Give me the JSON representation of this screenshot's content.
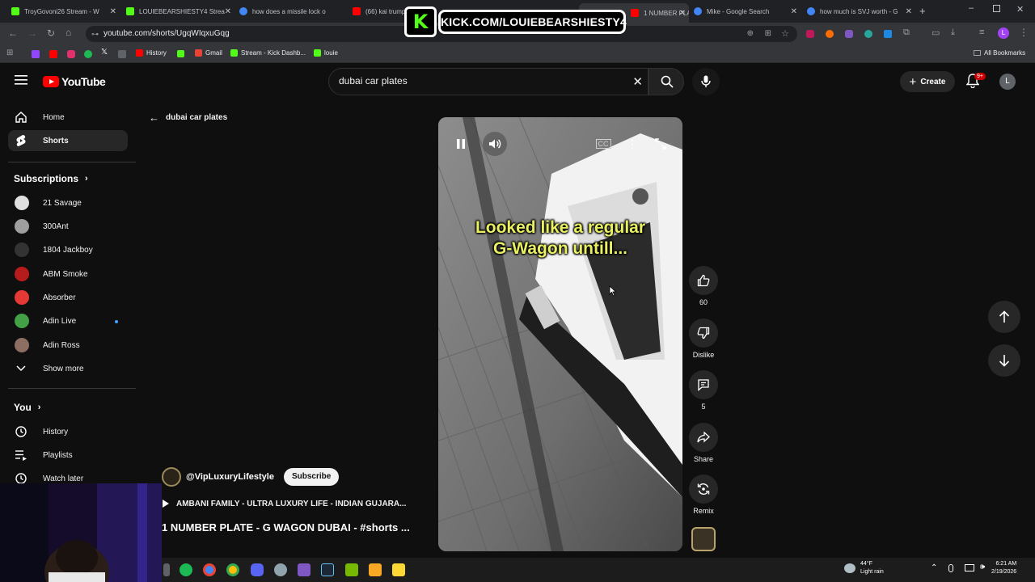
{
  "browser": {
    "tabs": [
      {
        "label": "TroyGovoni26 Stream - W",
        "icon_color": "#53fc18"
      },
      {
        "label": "LOUIEBEARSHIESTY4 Strea",
        "icon_color": "#53fc18"
      },
      {
        "label": "how does a missile lock o",
        "icon_color": "#4285f4"
      },
      {
        "label": "(66) kai trump",
        "icon_color": "#ff0000"
      },
      {
        "label": "1 NUMBER PLATE",
        "icon_color": "#ff0000"
      },
      {
        "label": "Mike - Google Search",
        "icon_color": "#4285f4"
      },
      {
        "label": "how much is SVJ worth - G",
        "icon_color": "#4285f4"
      }
    ],
    "url": "youtube.com/shorts/UgqWIqxuGqg",
    "bookmarks": [
      "History",
      "Gmail",
      "Stream - Kick Dashb...",
      "louie"
    ],
    "all_bookmarks_label": "All Bookmarks"
  },
  "overlay": {
    "logo_letter": "K",
    "text": "KICK.COM/LOUIEBEARSHIESTY4"
  },
  "header": {
    "logo_text": "YouTube",
    "search_value": "dubai car plates",
    "create_label": "Create",
    "notif_badge": "9+",
    "avatar_letter": "L"
  },
  "sidebar": {
    "main": [
      {
        "label": "Home",
        "icon": "home-icon"
      },
      {
        "label": "Shorts",
        "icon": "shorts-icon"
      }
    ],
    "subscriptions_heading": "Subscriptions",
    "subscriptions": [
      {
        "label": "21 Savage",
        "color": "#e0e0e0"
      },
      {
        "label": "300Ant",
        "color": "#9e9e9e"
      },
      {
        "label": "1804 Jackboy",
        "color": "#333333"
      },
      {
        "label": "ABM Smoke",
        "color": "#b71c1c"
      },
      {
        "label": "Absorber",
        "color": "#e53935"
      },
      {
        "label": "Adin Live",
        "color": "#43a047"
      },
      {
        "label": "Adin Ross",
        "color": "#8d6e63"
      }
    ],
    "show_more": "Show more",
    "you_heading": "You",
    "you_items": [
      {
        "label": "History",
        "icon": "history-icon"
      },
      {
        "label": "Playlists",
        "icon": "playlists-icon"
      },
      {
        "label": "Watch later",
        "icon": "watch-later-icon"
      }
    ]
  },
  "main": {
    "back_label": "dubai car plates",
    "caption_line1": "Looked like a regular",
    "caption_line2": "G-Wagon untill...",
    "channel_name": "@VipLuxuryLifestyle",
    "subscribe_label": "Subscribe",
    "related_text": "AMBANI FAMILY - ULTRA LUXURY LIFE - INDIAN GUJARA...",
    "title": "1 NUMBER PLATE - G WAGON DUBAI - #shorts ..."
  },
  "actions": {
    "likes": "60",
    "dislike": "Dislike",
    "comments": "5",
    "share": "Share",
    "remix": "Remix"
  },
  "taskbar": {
    "weather_temp": "44°F",
    "weather_desc": "Light rain",
    "time": "6:21 AM",
    "date": "2/19/2026"
  }
}
